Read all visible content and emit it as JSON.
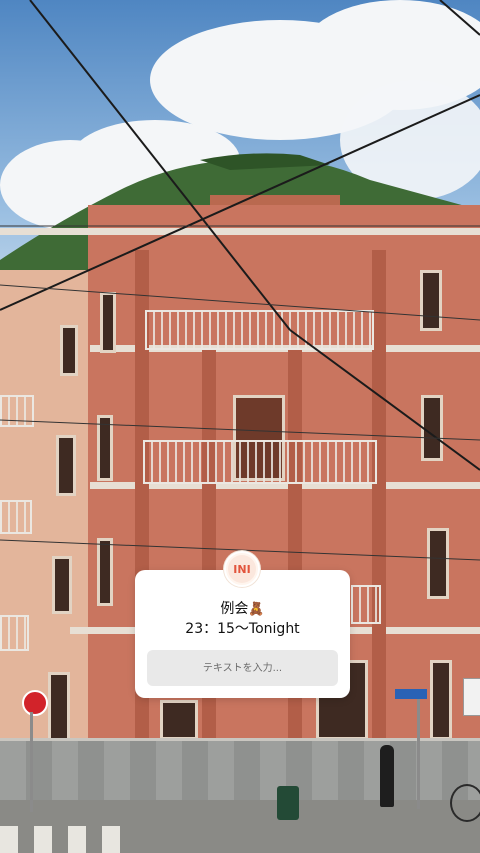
{
  "story": {
    "question_card": {
      "avatar_text": "INI",
      "title": "例会",
      "title_emoji": "🧸",
      "subtitle": "23：15～Tonight",
      "reply_placeholder": "テキストを入力..."
    }
  },
  "background": {
    "description_icon": "photo-icon"
  },
  "colors": {
    "card": "#ffffff",
    "reply_field": "#e9e9e9",
    "building": "#c9755f"
  }
}
